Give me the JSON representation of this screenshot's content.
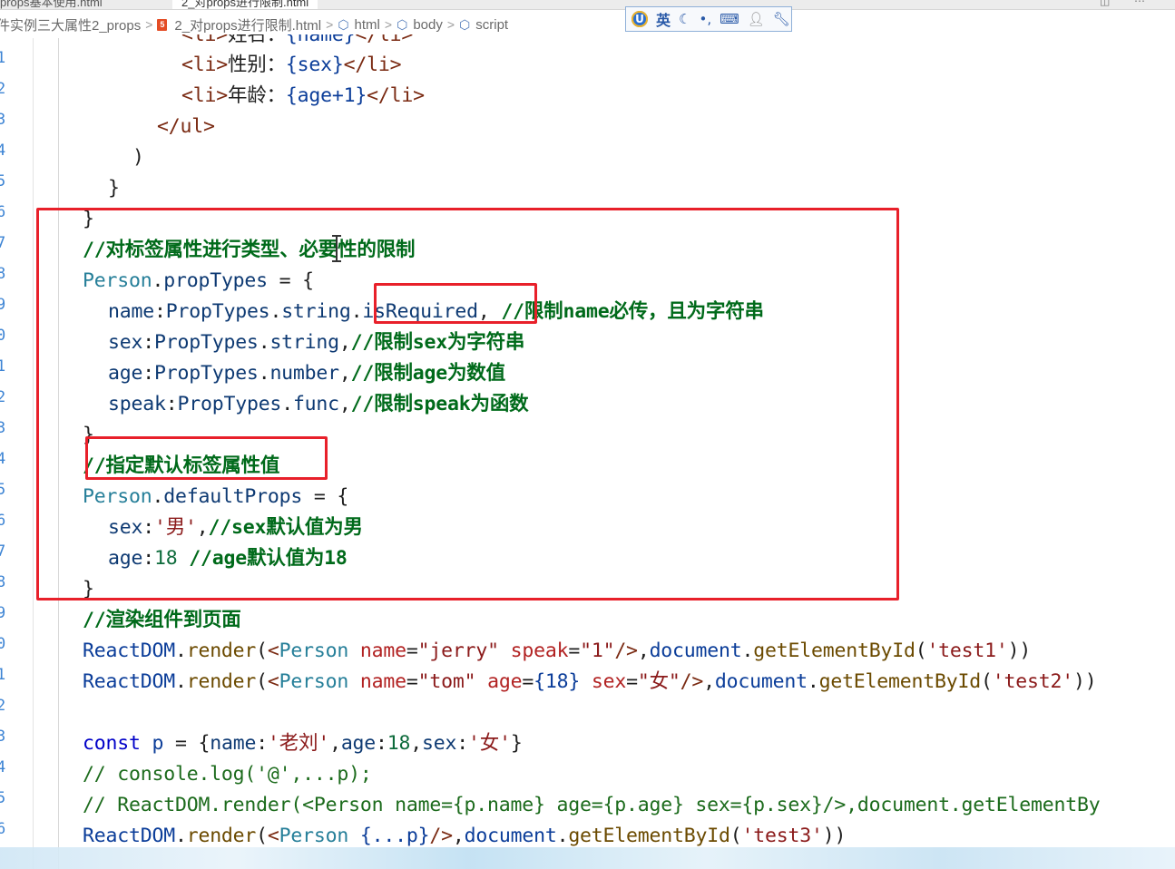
{
  "tabs": {
    "inactive_label": "props基本使用.html",
    "active_label": "2_对props进行限制.html"
  },
  "breadcrumb": {
    "items": [
      {
        "label": "件实例三大属性2_props",
        "icon": "none"
      },
      {
        "label": "2_对props进行限制.html",
        "icon": "html5-icon"
      },
      {
        "label": "html",
        "icon": "cube-icon"
      },
      {
        "label": "body",
        "icon": "cube-icon"
      },
      {
        "label": "script",
        "icon": "cube-icon"
      }
    ],
    "separator": ">"
  },
  "ime_toolbar": {
    "logo": "U",
    "language": "英",
    "icons": [
      "moon-icon",
      "punctuation-icon",
      "keyboard-icon",
      "user-icon",
      "wrench-icon"
    ]
  },
  "gutter": {
    "line_numbers": [
      "1",
      "2",
      "3",
      "4",
      "5",
      "6",
      "7",
      "8",
      "9",
      "0",
      "1",
      "2",
      "3",
      "4",
      "5",
      "6",
      "7",
      "8",
      "9",
      "0",
      "1",
      "2",
      "3",
      "4",
      "5",
      "6"
    ]
  },
  "code_lines": [
    {
      "tokens": [
        [
          "c-tag",
          "<li>"
        ],
        [
          "c-default cjk",
          "姓名："
        ],
        [
          "c-brace",
          "{name}"
        ],
        [
          "c-tag",
          "</li>"
        ]
      ]
    },
    {
      "tokens": [
        [
          "c-tag",
          "<li>"
        ],
        [
          "c-default cjk",
          "性别："
        ],
        [
          "c-brace",
          "{sex}"
        ],
        [
          "c-tag",
          "</li>"
        ]
      ]
    },
    {
      "tokens": [
        [
          "c-tag",
          "<li>"
        ],
        [
          "c-default cjk",
          "年龄："
        ],
        [
          "c-brace",
          "{age+1}"
        ],
        [
          "c-tag",
          "</li>"
        ]
      ]
    },
    {
      "tokens": [
        [
          "c-tag",
          "</ul>"
        ]
      ]
    },
    {
      "tokens": [
        [
          "c-default",
          ")"
        ]
      ]
    },
    {
      "tokens": [
        [
          "c-default",
          "}"
        ]
      ]
    },
    {
      "tokens": [
        [
          "c-default",
          "}"
        ]
      ]
    },
    {
      "tokens": [
        [
          "c-comment",
          "//"
        ],
        [
          "c-comment cjk",
          "对标签属性进行类型、必要性的限制"
        ]
      ]
    },
    {
      "tokens": [
        [
          "c-class",
          "Person"
        ],
        [
          "c-default",
          "."
        ],
        [
          "c-prop",
          "propTypes"
        ],
        [
          "c-default",
          " = {"
        ]
      ]
    },
    {
      "tokens": [
        [
          "c-prop",
          "name"
        ],
        [
          "c-default",
          ":"
        ],
        [
          "c-prop",
          "PropTypes"
        ],
        [
          "c-default",
          "."
        ],
        [
          "c-prop",
          "string"
        ],
        [
          "c-default",
          "."
        ],
        [
          "c-prop",
          "isRequired"
        ],
        [
          "c-default",
          ", "
        ],
        [
          "c-comment",
          "//"
        ],
        [
          "c-comment cjk",
          "限制"
        ],
        [
          "c-comment",
          "name"
        ],
        [
          "c-comment cjk",
          "必传，且为字符串"
        ]
      ]
    },
    {
      "tokens": [
        [
          "c-prop",
          "sex"
        ],
        [
          "c-default",
          ":"
        ],
        [
          "c-prop",
          "PropTypes"
        ],
        [
          "c-default",
          "."
        ],
        [
          "c-prop",
          "string"
        ],
        [
          "c-default",
          ","
        ],
        [
          "c-comment",
          "//"
        ],
        [
          "c-comment cjk",
          "限制"
        ],
        [
          "c-comment",
          "sex"
        ],
        [
          "c-comment cjk",
          "为字符串"
        ]
      ]
    },
    {
      "tokens": [
        [
          "c-prop",
          "age"
        ],
        [
          "c-default",
          ":"
        ],
        [
          "c-prop",
          "PropTypes"
        ],
        [
          "c-default",
          "."
        ],
        [
          "c-prop",
          "number"
        ],
        [
          "c-default",
          ","
        ],
        [
          "c-comment",
          "//"
        ],
        [
          "c-comment cjk",
          "限制"
        ],
        [
          "c-comment",
          "age"
        ],
        [
          "c-comment cjk",
          "为数值"
        ]
      ]
    },
    {
      "tokens": [
        [
          "c-prop",
          "speak"
        ],
        [
          "c-default",
          ":"
        ],
        [
          "c-prop",
          "PropTypes"
        ],
        [
          "c-default",
          "."
        ],
        [
          "c-prop",
          "func"
        ],
        [
          "c-default",
          ","
        ],
        [
          "c-comment",
          "//"
        ],
        [
          "c-comment cjk",
          "限制"
        ],
        [
          "c-comment",
          "speak"
        ],
        [
          "c-comment cjk",
          "为函数"
        ]
      ]
    },
    {
      "tokens": [
        [
          "c-default",
          "}"
        ]
      ]
    },
    {
      "tokens": [
        [
          "c-comment",
          "//"
        ],
        [
          "c-comment cjk",
          "指定默认标签属性值"
        ]
      ]
    },
    {
      "tokens": [
        [
          "c-class",
          "Person"
        ],
        [
          "c-default",
          "."
        ],
        [
          "c-prop",
          "defaultProps"
        ],
        [
          "c-default",
          " = {"
        ]
      ]
    },
    {
      "tokens": [
        [
          "c-prop",
          "sex"
        ],
        [
          "c-default",
          ":"
        ],
        [
          "c-string",
          "'"
        ],
        [
          "c-string cjk",
          "男"
        ],
        [
          "c-string",
          "'"
        ],
        [
          "c-default",
          ","
        ],
        [
          "c-comment",
          "//sex"
        ],
        [
          "c-comment cjk",
          "默认值为男"
        ]
      ]
    },
    {
      "tokens": [
        [
          "c-prop",
          "age"
        ],
        [
          "c-default",
          ":"
        ],
        [
          "c-num",
          "18"
        ],
        [
          "c-default",
          " "
        ],
        [
          "c-comment",
          "//age"
        ],
        [
          "c-comment cjk",
          "默认值为"
        ],
        [
          "c-comment",
          "18"
        ]
      ]
    },
    {
      "tokens": [
        [
          "c-default",
          "}"
        ]
      ]
    },
    {
      "tokens": [
        [
          "c-comment",
          "//"
        ],
        [
          "c-comment cjk",
          "渲染组件到页面"
        ]
      ]
    },
    {
      "tokens": [
        [
          "c-var",
          "ReactDOM"
        ],
        [
          "c-default",
          "."
        ],
        [
          "c-method",
          "render"
        ],
        [
          "c-default",
          "("
        ],
        [
          "c-tag",
          "<"
        ],
        [
          "c-class",
          "Person"
        ],
        [
          "c-default",
          " "
        ],
        [
          "c-attr",
          "name"
        ],
        [
          "c-default",
          "="
        ],
        [
          "c-string",
          "\"jerry\""
        ],
        [
          "c-default",
          " "
        ],
        [
          "c-attr",
          "speak"
        ],
        [
          "c-default",
          "="
        ],
        [
          "c-string",
          "\"1\""
        ],
        [
          "c-tag",
          "/>"
        ],
        [
          "c-default",
          ","
        ],
        [
          "c-var",
          "document"
        ],
        [
          "c-default",
          "."
        ],
        [
          "c-method",
          "getElementById"
        ],
        [
          "c-default",
          "("
        ],
        [
          "c-string",
          "'test1'"
        ],
        [
          "c-default",
          "))"
        ]
      ]
    },
    {
      "tokens": [
        [
          "c-var",
          "ReactDOM"
        ],
        [
          "c-default",
          "."
        ],
        [
          "c-method",
          "render"
        ],
        [
          "c-default",
          "("
        ],
        [
          "c-tag",
          "<"
        ],
        [
          "c-class",
          "Person"
        ],
        [
          "c-default",
          " "
        ],
        [
          "c-attr",
          "name"
        ],
        [
          "c-default",
          "="
        ],
        [
          "c-string",
          "\"tom\""
        ],
        [
          "c-default",
          " "
        ],
        [
          "c-attr",
          "age"
        ],
        [
          "c-default",
          "="
        ],
        [
          "c-brace",
          "{18}"
        ],
        [
          "c-default",
          " "
        ],
        [
          "c-attr",
          "sex"
        ],
        [
          "c-default",
          "="
        ],
        [
          "c-string",
          "\""
        ],
        [
          "c-string cjk",
          "女"
        ],
        [
          "c-string",
          "\""
        ],
        [
          "c-tag",
          "/>"
        ],
        [
          "c-default",
          ","
        ],
        [
          "c-var",
          "document"
        ],
        [
          "c-default",
          "."
        ],
        [
          "c-method",
          "getElementById"
        ],
        [
          "c-default",
          "("
        ],
        [
          "c-string",
          "'test2'"
        ],
        [
          "c-default",
          "))"
        ]
      ]
    },
    {
      "tokens": []
    },
    {
      "tokens": [
        [
          "c-kw",
          "const"
        ],
        [
          "c-default",
          " "
        ],
        [
          "c-var",
          "p"
        ],
        [
          "c-default",
          " = {"
        ],
        [
          "c-prop",
          "name"
        ],
        [
          "c-default",
          ":"
        ],
        [
          "c-string",
          "'"
        ],
        [
          "c-string cjk",
          "老刘"
        ],
        [
          "c-string",
          "'"
        ],
        [
          "c-default",
          ","
        ],
        [
          "c-prop",
          "age"
        ],
        [
          "c-default",
          ":"
        ],
        [
          "c-num",
          "18"
        ],
        [
          "c-default",
          ","
        ],
        [
          "c-prop",
          "sex"
        ],
        [
          "c-default",
          ":"
        ],
        [
          "c-string",
          "'"
        ],
        [
          "c-string cjk",
          "女"
        ],
        [
          "c-string",
          "'"
        ],
        [
          "c-default",
          "}"
        ]
      ]
    },
    {
      "tokens": [
        [
          "c-comment-plain",
          "// console.log('@',...p);"
        ]
      ]
    },
    {
      "tokens": [
        [
          "c-comment-plain",
          "// ReactDOM.render(<Person name={p.name} age={p.age} sex={p.sex}/>,document.getElementBy"
        ]
      ]
    },
    {
      "tokens": [
        [
          "c-var",
          "ReactDOM"
        ],
        [
          "c-default",
          "."
        ],
        [
          "c-method",
          "render"
        ],
        [
          "c-default",
          "("
        ],
        [
          "c-tag",
          "<"
        ],
        [
          "c-class",
          "Person"
        ],
        [
          "c-default",
          " "
        ],
        [
          "c-brace",
          "{...p}"
        ],
        [
          "c-tag",
          "/>"
        ],
        [
          "c-default",
          ","
        ],
        [
          "c-var",
          "document"
        ],
        [
          "c-default",
          "."
        ],
        [
          "c-method",
          "getElementById"
        ],
        [
          "c-default",
          "("
        ],
        [
          "c-string",
          "'test3'"
        ],
        [
          "c-default",
          "))"
        ]
      ]
    }
  ]
}
